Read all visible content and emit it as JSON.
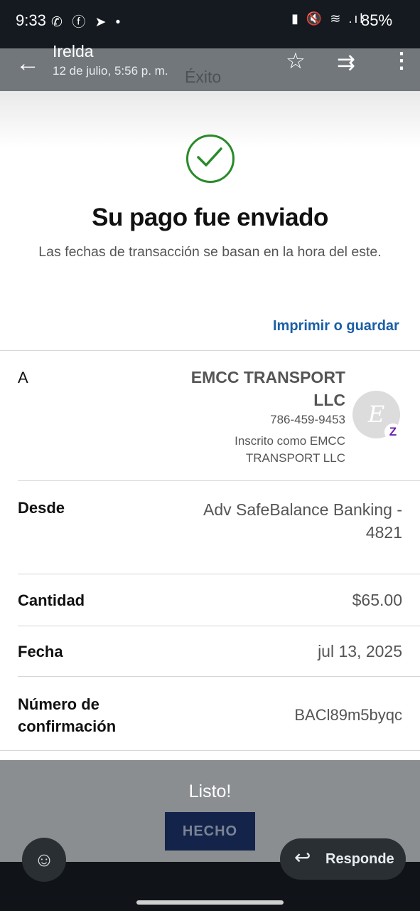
{
  "status_bar": {
    "time": "9:33",
    "left_icons": "✆ ⓕ ➤ •",
    "right_icons": "▮ 🔇 ≋ .ıl",
    "battery": "85%"
  },
  "app_bar": {
    "sender": "Irelda",
    "date": "12 de julio, 5:56 p. m.",
    "overlay_title": "Éxito"
  },
  "payment": {
    "title": "Su pago fue enviado",
    "note": "Las fechas de transacción se basan en la hora del este.",
    "print_link": "Imprimir o guardar",
    "to_label": "A",
    "to_name": "EMCC TRANSPORT LLC",
    "to_phone": "786-459-9453",
    "to_enrolled": "Inscrito como EMCC TRANSPORT LLC",
    "avatar_letter": "E",
    "from_label": "Desde",
    "from_value": "Adv SafeBalance Banking - 4821",
    "amount_label": "Cantidad",
    "amount_value": "$65.00",
    "date_label": "Fecha",
    "date_value": "jul 13, 2025",
    "conf_label": "Número de confirmación",
    "conf_value": "BACl89m5byqc"
  },
  "bottom": {
    "listo": "Listo!",
    "done_button": "HECHO",
    "reply": "Responde"
  }
}
